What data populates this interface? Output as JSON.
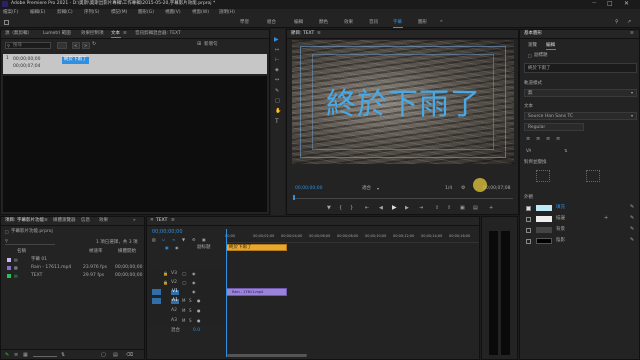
{
  "title": {
    "text": "Adobe Premiere Pro 2021 - D:\\奧斯\\奧斯出影片專輯\\工作專輯\\2015-05-20,字幕影片效能.prproj *"
  },
  "menu": [
    "檔案(F)",
    "編輯(E)",
    "剪輯(C)",
    "序列(S)",
    "標記(M)",
    "圖形(G)",
    "視圖(V)",
    "視窗(W)",
    "說明(H)"
  ],
  "workspaces": [
    "學習",
    "組合",
    "編輯",
    "顏色",
    "效果",
    "音訊",
    "字幕",
    "圖形"
  ],
  "workspace_active": "字幕",
  "captions_panel": {
    "tabs": [
      "源（無剪輯）",
      "Lumetri 範圍",
      "效果控制項",
      "文本",
      "音訊剪輯混合器: TEXT"
    ],
    "active_tab": "文本",
    "search_placeholder": "搜尋",
    "add_caption": "新增句",
    "item_time_in": "00;00;00;00",
    "item_time_out": "00;00;07;04",
    "item_text": "終於下雨了"
  },
  "program_monitor": {
    "tab": "節目: TEXT",
    "overlay_text": "終於下雨了",
    "timecode_current": "00;00;00;00",
    "fit": "適合",
    "quality": "1/4",
    "timecode_duration": "00;00;07;08"
  },
  "project_panel": {
    "tabs": [
      "項目: 字幕影片功能",
      "媒體瀏覽器",
      "信息",
      "效果"
    ],
    "project_file": "字幕影片功能.prproj",
    "items_info": "1 項已選擇，共 3 項",
    "col_name": "名稱",
    "col_fps": "幀速率",
    "col_media_start": "媒體開始",
    "items": [
      {
        "name": "字幕 01",
        "fps": "",
        "start": "",
        "color": "#c9b7f0"
      },
      {
        "name": "Rain - 17611.mp4",
        "fps": "23.976 fps",
        "start": "00;00;00;00",
        "color": "#8a6fd0"
      },
      {
        "name": "TEXT",
        "fps": "29.97 fps",
        "start": "00;00;00;00",
        "color": "#2fbf5a"
      }
    ]
  },
  "timeline": {
    "tab": "TEXT",
    "timecode": "00;00;00;00",
    "ruler": [
      "00;00",
      "00;00;02;00",
      "00;00;04;00",
      "00;00;06;00",
      "00;00;08;00",
      "00;00;10;00",
      "00;00;12;00",
      "00;00;14;00",
      "00;00;16;00"
    ],
    "subtitle_track": "副标题",
    "caption_clip": "終於下雨了",
    "video_tracks": [
      "V3",
      "V2",
      "V1"
    ],
    "audio_tracks": [
      "A1",
      "A2",
      "A3"
    ],
    "video_clip": "Rain - 17611.mp4",
    "master_label": "混合",
    "master_value": "0.0"
  },
  "essential_graphics": {
    "tab": "基本圖形",
    "tabs": [
      "瀏覽",
      "編輯"
    ],
    "active_tab": "編輯",
    "layer_name": "副標題",
    "text_value": "終於下雨了",
    "style_label": "軌道樣式",
    "style_value": "無",
    "text_section": "文本",
    "font": "Source Han Sans TC",
    "font_style": "Regular",
    "align_label": "對齊並變換",
    "appearance_label": "外觀",
    "fill_label": "填充",
    "stroke_label": "描邊",
    "bg_label": "背景",
    "shadow_label": "陰影",
    "fill_color": "#bde8f6",
    "accent": "#2f8fe0"
  }
}
